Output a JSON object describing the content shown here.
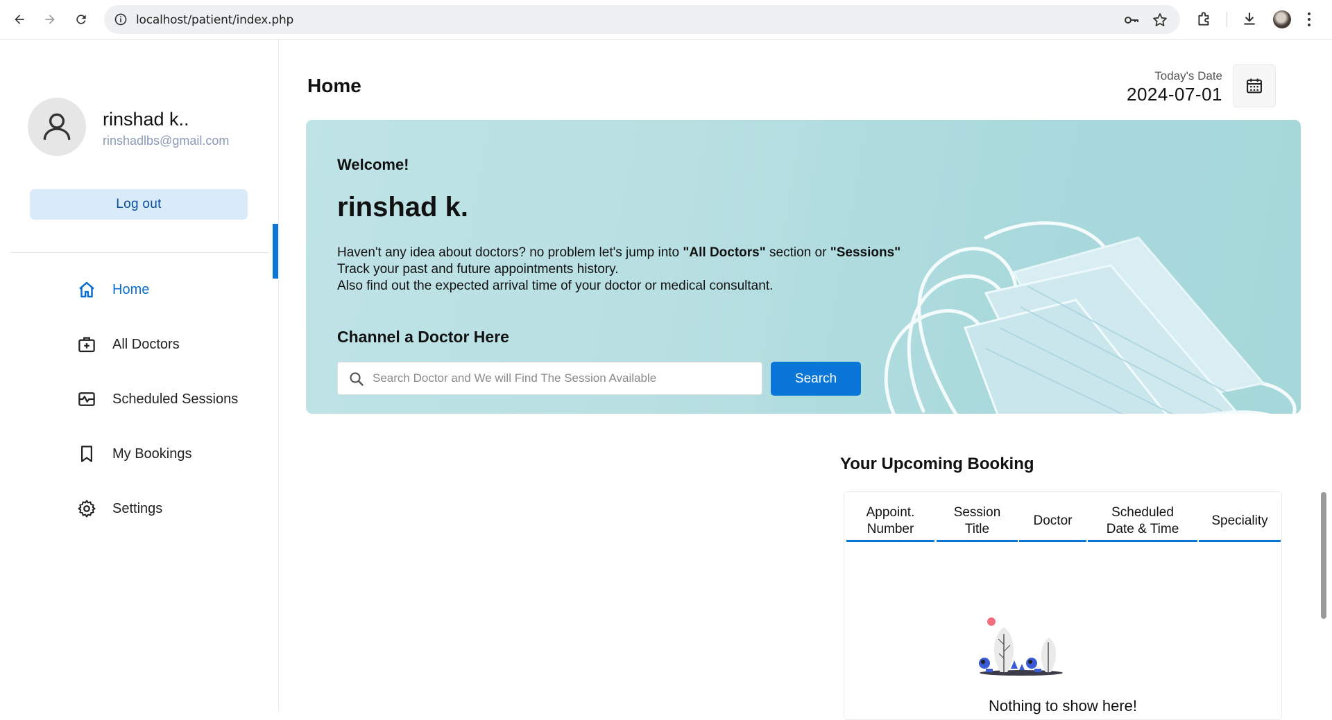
{
  "browser": {
    "url": "localhost/patient/index.php"
  },
  "profile": {
    "name": "rinshad k..",
    "email": "rinshadlbs@gmail.com",
    "logout_label": "Log out"
  },
  "menu": [
    {
      "label": "Home",
      "icon": "home-icon",
      "active": true
    },
    {
      "label": "All Doctors",
      "icon": "medical-bag-icon",
      "active": false
    },
    {
      "label": "Scheduled Sessions",
      "icon": "schedule-pulse-icon",
      "active": false
    },
    {
      "label": "My Bookings",
      "icon": "bookmark-icon",
      "active": false
    },
    {
      "label": "Settings",
      "icon": "gear-icon",
      "active": false
    }
  ],
  "header": {
    "title": "Home",
    "date_label": "Today's Date",
    "date_value": "2024-07-01"
  },
  "banner": {
    "welcome": "Welcome!",
    "name": "rinshad k.",
    "line1_pre": "Haven't any idea about doctors? no problem let's jump into ",
    "line1_b1": "\"All Doctors\"",
    "line1_mid": " section or ",
    "line1_b2": "\"Sessions\"",
    "line2": "Track your past and future appointments history.",
    "line3": "Also find out the expected arrival time of your doctor or medical consultant.",
    "channel_title": "Channel a Doctor Here",
    "search_placeholder": "Search Doctor and We will Find The Session Available",
    "search_label": "Search"
  },
  "booking": {
    "title": "Your Upcoming Booking",
    "columns": [
      {
        "line1": "Appoint.",
        "line2": "Number"
      },
      {
        "line1": "Session",
        "line2": "Title"
      },
      {
        "line1": "Doctor",
        "line2": ""
      },
      {
        "line1": "Scheduled",
        "line2": "Date & Time"
      },
      {
        "line1": "Speciality",
        "line2": ""
      }
    ],
    "empty_text": "Nothing to show here!"
  },
  "colors": {
    "accent": "#0a76d8",
    "logout_bg": "#d9eaf9",
    "banner_bg": "#b7dfe2",
    "email": "#8a9ab5"
  }
}
